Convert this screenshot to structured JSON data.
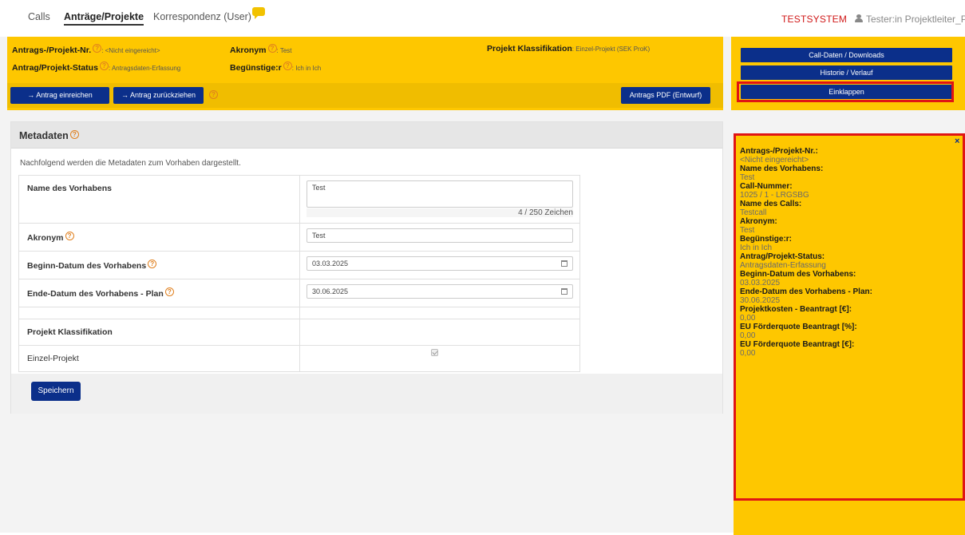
{
  "nav": {
    "tabs": [
      {
        "label": "Calls"
      },
      {
        "label": "Anträge/Projekte"
      },
      {
        "label": "Korrespondenz (User)"
      }
    ],
    "system_label": "TESTSYSTEM",
    "user_label": "Tester:in Projektleiter_PT"
  },
  "header": {
    "antrag_nr_label": "Antrags-/Projekt-Nr.",
    "antrag_nr_value": ": <Nicht eingereicht>",
    "status_label": "Antrag/Projekt-Status",
    "status_value": ": Antragsdaten-Erfassung",
    "akronym_label": "Akronym",
    "akronym_value": ": Test",
    "beguenstiger_label": "Begünstige:r",
    "beguenstiger_value": ": Ich in Ich",
    "klassifikation_label": "Projekt Klassifikation",
    "klassifikation_value": ": Einzel-Projekt (SEK ProK)",
    "btn_einreichen": "→ Antrag einreichen",
    "btn_zurueckziehen": "→ Antrag zurückziehen",
    "btn_pdf": "Antrags PDF (Entwurf)"
  },
  "right_panel": {
    "btn_call_daten": "Call-Daten / Downloads",
    "btn_historie": "Historie / Verlauf",
    "btn_einklappen": "Einklappen"
  },
  "metadata": {
    "title": "Metadaten",
    "description": "Nachfolgend werden die Metadaten zum Vorhaben dargestellt.",
    "name_label": "Name des Vorhabens",
    "name_value": "Test",
    "name_counter": "4 / 250 Zeichen",
    "akronym_label": "Akronym",
    "akronym_value": "Test",
    "beginn_label": "Beginn-Datum des Vorhabens",
    "beginn_value": "03.03.2025",
    "ende_label": "Ende-Datum des Vorhabens - Plan",
    "ende_value": "30.06.2025",
    "klassifikation_header": "Projekt Klassifikation",
    "klassifikation_option": "Einzel-Projekt",
    "save_label": "Speichern"
  },
  "side_panel": {
    "close": "×",
    "items": [
      {
        "key": "Antrags-/Projekt-Nr.:",
        "value": "<Nicht eingereicht>"
      },
      {
        "key": "Name des Vorhabens:",
        "value": "Test"
      },
      {
        "key": "Call-Nummer:",
        "value": "1025 / 1 - LRGSBG"
      },
      {
        "key": "Name des Calls:",
        "value": "Testcall"
      },
      {
        "key": "Akronym:",
        "value": "Test"
      },
      {
        "key": "Begünstige:r:",
        "value": "Ich in Ich"
      },
      {
        "key": "Antrag/Projekt-Status:",
        "value": "Antragsdaten-Erfassung"
      },
      {
        "key": "Beginn-Datum des Vorhabens:",
        "value": "03.03.2025"
      },
      {
        "key": "Ende-Datum des Vorhabens - Plan:",
        "value": "30.06.2025"
      },
      {
        "key": "Projektkosten - Beantragt [€]:",
        "value": "0,00"
      },
      {
        "key": "EU Förderquote Beantragt [%]:",
        "value": "0,00"
      },
      {
        "key": "EU Förderquote Beantragt [€]:",
        "value": "0,00"
      }
    ]
  },
  "help_glyph": "?"
}
